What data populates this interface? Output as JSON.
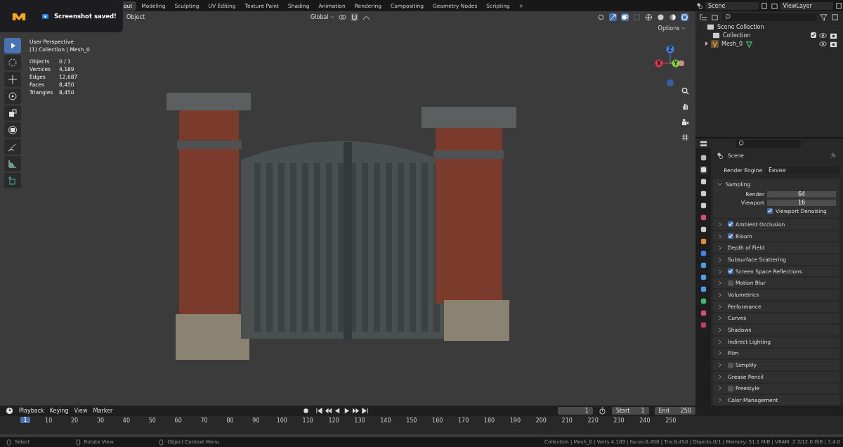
{
  "toast": {
    "message": "Screenshot saved!"
  },
  "workspace_tabs": [
    {
      "label": "out",
      "selected": true
    },
    {
      "label": "Modeling",
      "selected": false
    },
    {
      "label": "Sculpting",
      "selected": false
    },
    {
      "label": "UV Editing",
      "selected": false
    },
    {
      "label": "Texture Paint",
      "selected": false
    },
    {
      "label": "Shading",
      "selected": false
    },
    {
      "label": "Animation",
      "selected": false
    },
    {
      "label": "Rendering",
      "selected": false
    },
    {
      "label": "Compositing",
      "selected": false
    },
    {
      "label": "Geometry Nodes",
      "selected": false
    },
    {
      "label": "Scripting",
      "selected": false
    }
  ],
  "add_tab": "+",
  "scene_field": "Scene",
  "view_layer_field": "ViewLayer",
  "viewport": {
    "menu": "Object",
    "orientation": "Global",
    "options": "Options",
    "overlay_lines": [
      "User Perspective",
      "(1) Collection | Mesh_0"
    ],
    "stats": [
      {
        "label": "Objects",
        "value": "0 / 1"
      },
      {
        "label": "Vertices",
        "value": "4,189"
      },
      {
        "label": "Edges",
        "value": "12,687"
      },
      {
        "label": "Faces",
        "value": "8,450"
      },
      {
        "label": "Triangles",
        "value": "8,450"
      }
    ],
    "gizmo_axes": [
      "X",
      "Y",
      "Z"
    ],
    "tools": [
      {
        "kind": "select",
        "selected": true
      },
      {
        "kind": "cursor",
        "selected": false
      },
      {
        "kind": "move",
        "selected": false
      },
      {
        "kind": "rotate",
        "selected": false
      },
      {
        "kind": "scale",
        "selected": false
      },
      {
        "kind": "transform",
        "selected": false
      },
      {
        "kind": "annotate",
        "selected": false
      },
      {
        "kind": "measure",
        "selected": false
      },
      {
        "kind": "add",
        "selected": false
      }
    ]
  },
  "outliner": {
    "root": "Scene Collection",
    "children": [
      {
        "label": "Collection",
        "kind": "collection",
        "checked": true
      },
      {
        "label": "Mesh_0",
        "kind": "mesh",
        "expanded": false
      }
    ]
  },
  "properties": {
    "context": "Scene",
    "engine_label": "Render Engine",
    "engine": "Eevee",
    "sampling": {
      "title": "Sampling",
      "expanded": true,
      "fields": [
        {
          "label": "Render",
          "value": "64"
        },
        {
          "label": "Viewport",
          "value": "16"
        }
      ],
      "denoise": {
        "label": "Viewport Denoising",
        "checked": true
      }
    },
    "panels": [
      {
        "label": "Ambient Occlusion",
        "kind": "toggle",
        "checked": true
      },
      {
        "label": "Bloom",
        "kind": "toggle",
        "checked": true
      },
      {
        "label": "Depth of Field",
        "kind": "plain"
      },
      {
        "label": "Subsurface Scattering",
        "kind": "plain"
      },
      {
        "label": "Screen Space Reflections",
        "kind": "toggle",
        "checked": true
      },
      {
        "label": "Motion Blur",
        "kind": "toggle",
        "checked": false
      },
      {
        "label": "Volumetrics",
        "kind": "plain"
      },
      {
        "label": "Performance",
        "kind": "plain"
      },
      {
        "label": "Curves",
        "kind": "plain"
      },
      {
        "label": "Shadows",
        "kind": "plain"
      },
      {
        "label": "Indirect Lighting",
        "kind": "plain"
      },
      {
        "label": "Film",
        "kind": "plain"
      },
      {
        "label": "Simplify",
        "kind": "toggle",
        "checked": false
      },
      {
        "label": "Grease Pencil",
        "kind": "plain"
      },
      {
        "label": "Freestyle",
        "kind": "toggle",
        "checked": false
      },
      {
        "label": "Color Management",
        "kind": "plain"
      }
    ]
  },
  "timeline": {
    "menus": [
      "Playback",
      "Keying",
      "View",
      "Marker"
    ],
    "current_frame": "1",
    "start_label": "Start",
    "start": "1",
    "end_label": "End",
    "end": "250",
    "ruler": [
      "10",
      "20",
      "30",
      "40",
      "50",
      "60",
      "70",
      "80",
      "90",
      "100",
      "110",
      "120",
      "130",
      "140",
      "150",
      "160",
      "170",
      "180",
      "190",
      "200",
      "210",
      "220",
      "230",
      "240",
      "250"
    ],
    "playhead": "1"
  },
  "status_bar": {
    "hints": [
      "Select",
      "Rotate View",
      "Object Context Menu"
    ],
    "info": "Collection | Mesh_0 | Verts:4,189 | Faces:8,450 | Tris:8,450 | Objects:0/1 | Memory: 51.1 MiB | VRAM: 2.3/12.0 GiB | 3.4.0"
  }
}
